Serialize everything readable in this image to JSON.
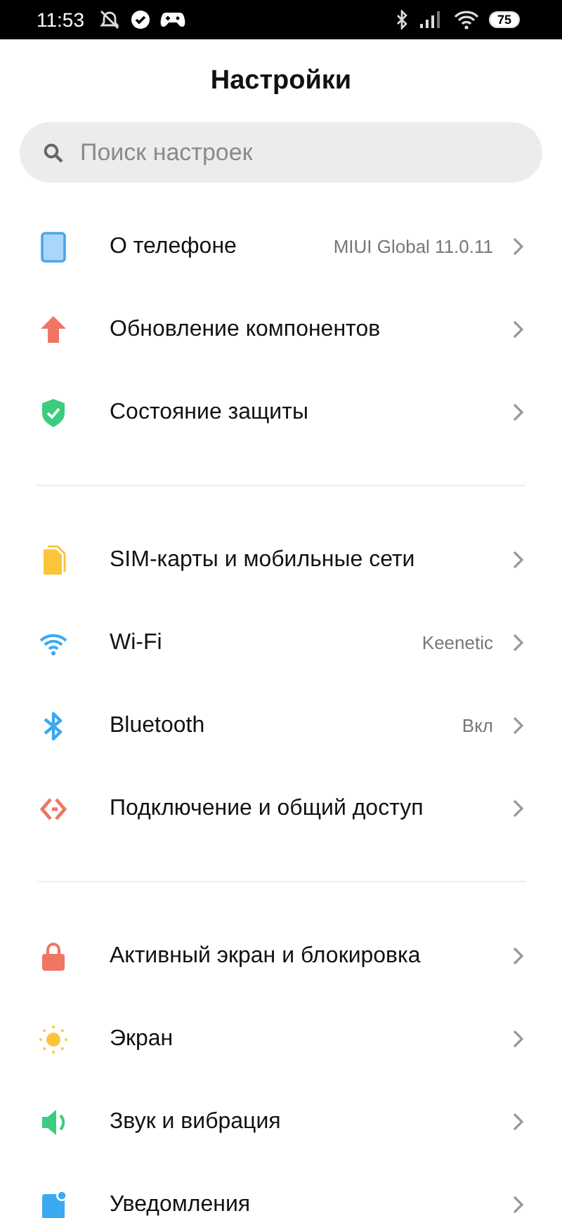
{
  "status_bar": {
    "time": "11:53",
    "battery": "75"
  },
  "title": "Настройки",
  "search": {
    "placeholder": "Поиск настроек"
  },
  "groups": [
    {
      "items": [
        {
          "kind": "phone",
          "label": "О телефоне",
          "value": "MIUI Global 11.0.11"
        },
        {
          "kind": "update",
          "label": "Обновление компонентов"
        },
        {
          "kind": "shield",
          "label": "Состояние защиты"
        }
      ]
    },
    {
      "items": [
        {
          "kind": "sim",
          "label": "SIM-карты и мобильные сети"
        },
        {
          "kind": "wifi",
          "label": "Wi-Fi",
          "value": "Keenetic"
        },
        {
          "kind": "bluetooth",
          "label": "Bluetooth",
          "value": "Вкл"
        },
        {
          "kind": "share",
          "label": "Подключение и общий доступ"
        }
      ]
    },
    {
      "items": [
        {
          "kind": "lock",
          "label": "Активный экран и блокировка"
        },
        {
          "kind": "sun",
          "label": "Экран"
        },
        {
          "kind": "sound",
          "label": "Звук и вибрация"
        },
        {
          "kind": "notification",
          "label": "Уведомления"
        }
      ]
    }
  ]
}
